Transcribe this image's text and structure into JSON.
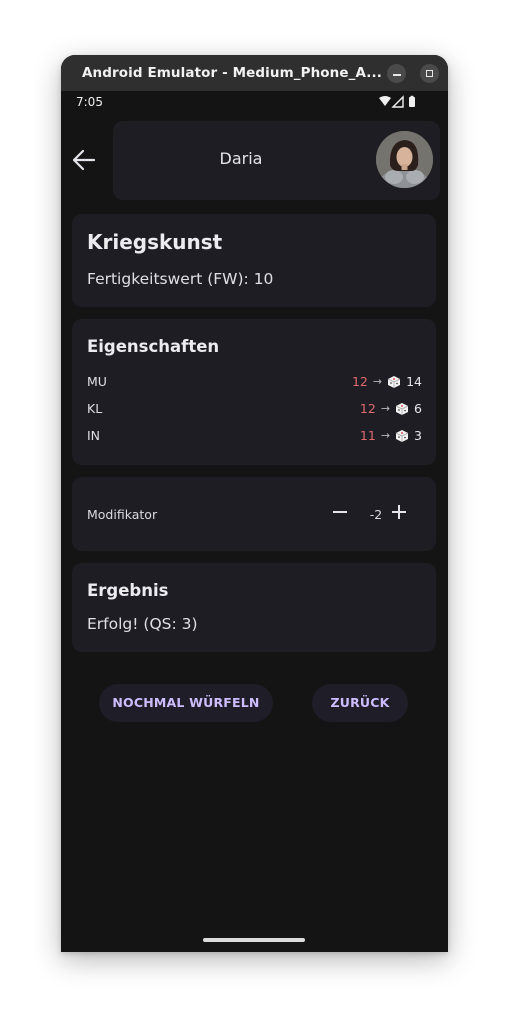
{
  "window": {
    "title": "Android Emulator - Medium_Phone_A..."
  },
  "status_bar": {
    "time": "7:05"
  },
  "header": {
    "character_name": "Daria"
  },
  "skill": {
    "name": "Kriegskunst",
    "value_line": "Fertigkeitswert (FW): 10"
  },
  "attributes": {
    "title": "Eigenschaften",
    "rows": [
      {
        "name": "MU",
        "value": "12",
        "roll": "14"
      },
      {
        "name": "KL",
        "value": "12",
        "roll": "6"
      },
      {
        "name": "IN",
        "value": "11",
        "roll": "3"
      }
    ]
  },
  "modifier": {
    "label": "Modifikator",
    "value": "-2"
  },
  "result": {
    "title": "Ergebnis",
    "text": "Erfolg! (QS: 3)"
  },
  "actions": {
    "reroll_label": "NOCHMAL WÜRFELN",
    "back_label": "ZURÜCK"
  },
  "colors": {
    "accent": "#cdbdff",
    "attribute_value": "#e06a6d",
    "card": "#1e1d24",
    "background": "#141414"
  },
  "icons": [
    "back-arrow-icon",
    "wifi-icon",
    "signal-icon",
    "battery-icon",
    "dice-icon",
    "minus-icon",
    "plus-icon"
  ]
}
